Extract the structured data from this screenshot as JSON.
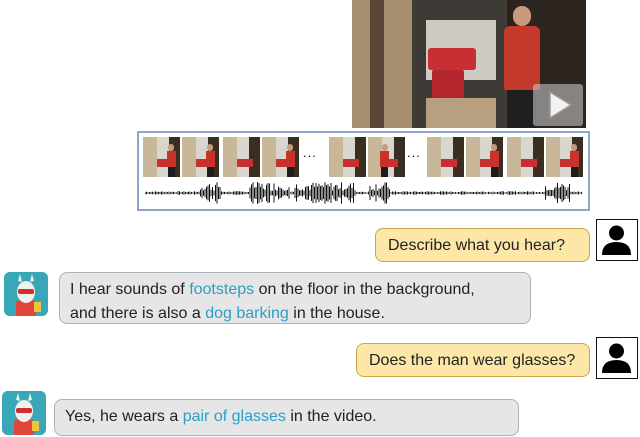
{
  "colors": {
    "user_bubble": "#fce7a8",
    "bot_bubble": "#e6e6e6",
    "highlight": "#2aa0c4",
    "strip_border": "#8fa6c6"
  },
  "video": {
    "play_icon": "play-icon",
    "ellipsis": "..."
  },
  "chat": [
    {
      "role": "user",
      "text": "Describe what you hear?"
    },
    {
      "role": "bot",
      "line1_before": "I hear sounds of ",
      "line1_highlight": "footsteps",
      "line1_after": " on the floor in the background,",
      "line2_before": "and there is also a ",
      "line2_highlight": "dog barking",
      "line2_after": " in the house."
    },
    {
      "role": "user",
      "text": "Does the man wear glasses?"
    },
    {
      "role": "bot",
      "before": "Yes, he wears a ",
      "highlight": "pair of glasses",
      "after": " in the video."
    }
  ]
}
